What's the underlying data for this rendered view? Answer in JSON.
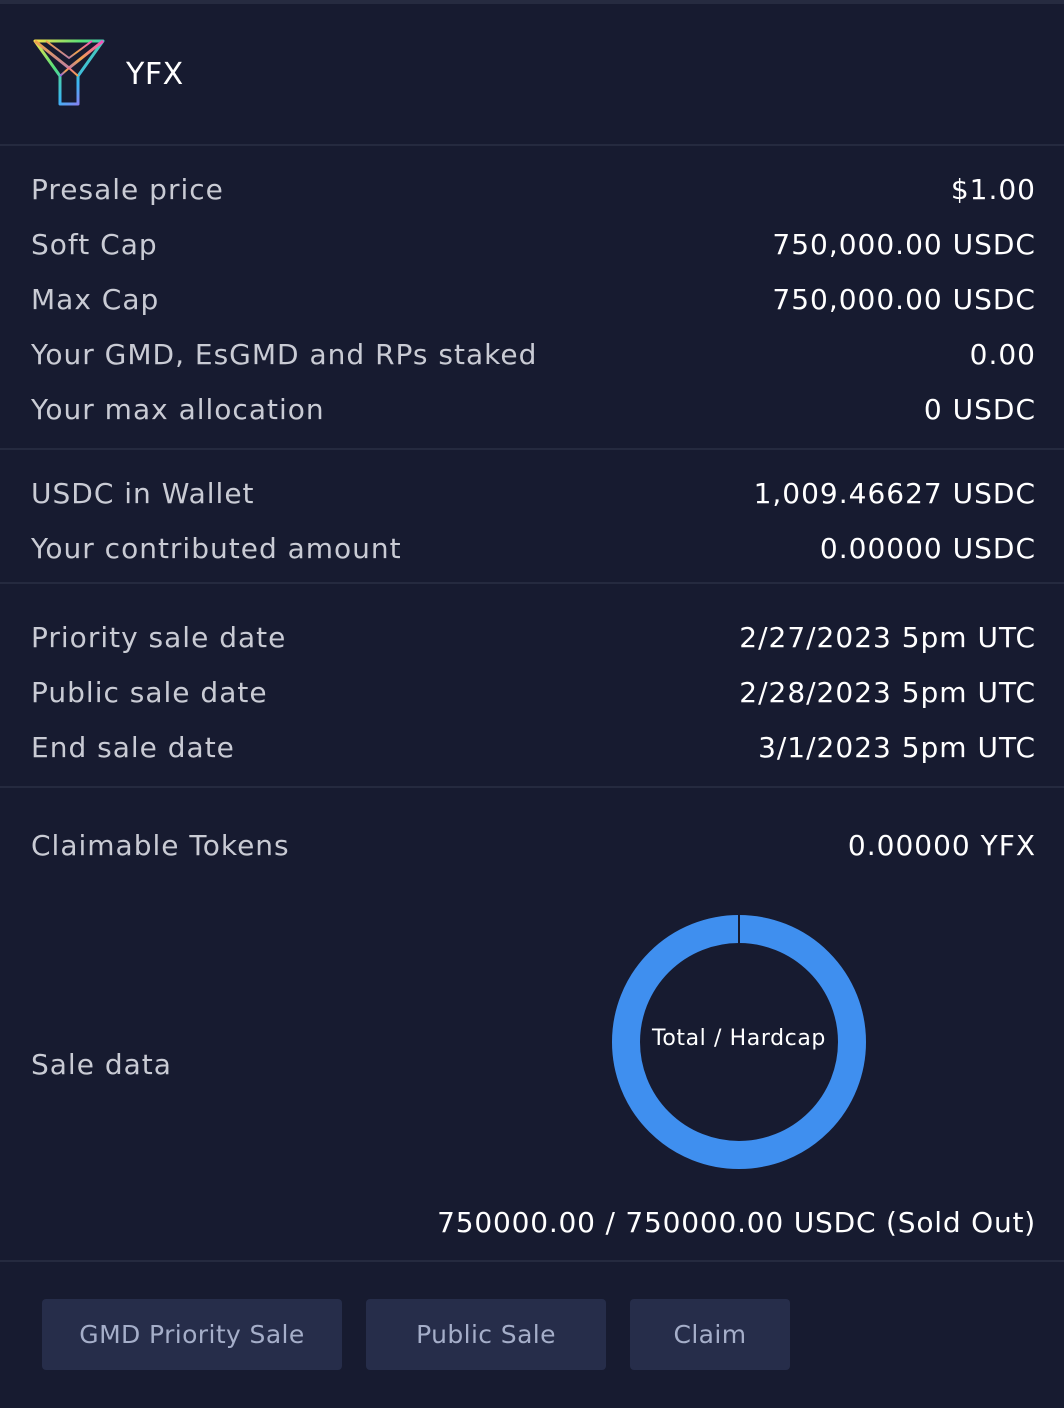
{
  "header": {
    "token_name": "YFX",
    "logo_icon": "yfx-prism-logo-icon"
  },
  "overview": {
    "presale_price": {
      "label": "Presale price",
      "value": "$1.00"
    },
    "soft_cap": {
      "label": "Soft Cap",
      "value": "750,000.00 USDC"
    },
    "max_cap": {
      "label": "Max Cap",
      "value": "750,000.00 USDC"
    },
    "staked": {
      "label": "Your GMD, EsGMD and RPs staked",
      "value": "0.00"
    },
    "max_allocation": {
      "label": "Your max allocation",
      "value": "0 USDC"
    }
  },
  "wallet": {
    "usdc_in_wallet": {
      "label": "USDC in Wallet",
      "value": "1,009.46627 USDC"
    },
    "contributed": {
      "label": "Your contributed amount",
      "value": "0.00000 USDC"
    }
  },
  "dates": {
    "priority_sale": {
      "label": "Priority sale date",
      "value": "2/27/2023 5pm UTC"
    },
    "public_sale": {
      "label": "Public sale date",
      "value": "2/28/2023 5pm UTC"
    },
    "end_sale": {
      "label": "End sale date",
      "value": "3/1/2023 5pm UTC"
    }
  },
  "claim": {
    "claimable": {
      "label": "Claimable Tokens",
      "value": "0.00000 YFX"
    }
  },
  "sale_data": {
    "label": "Sale data",
    "donut_center_label": "Total / Hardcap",
    "total_text": "750000.00 / 750000.00 USDC (Sold Out)",
    "raised": 750000,
    "hardcap": 750000,
    "fill_color": "#3f8fef",
    "track_color": "#22273d"
  },
  "actions": {
    "priority_sale_button": "GMD Priority Sale",
    "public_sale_button": "Public Sale",
    "claim_button": "Claim"
  }
}
